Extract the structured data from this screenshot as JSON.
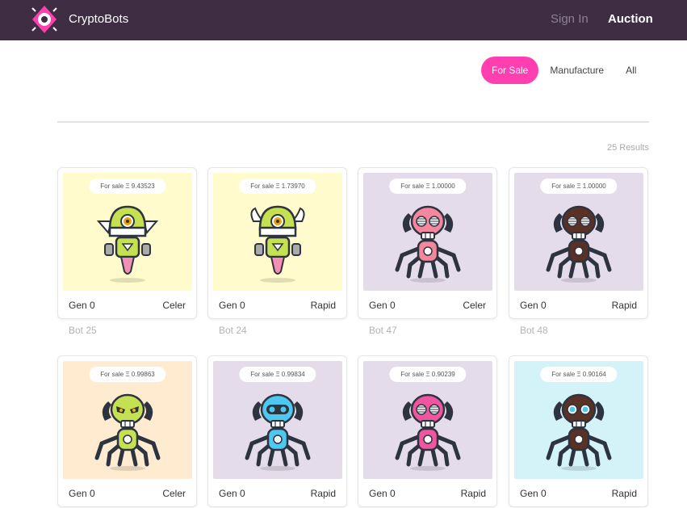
{
  "header": {
    "brand": "CryptoBots",
    "nav": [
      {
        "label": "Sign In"
      },
      {
        "label": "Auction"
      }
    ]
  },
  "filters": [
    {
      "label": "For Sale",
      "active": true
    },
    {
      "label": "Manufacture",
      "active": false
    },
    {
      "label": "All",
      "active": false
    }
  ],
  "results_text": "25 Results",
  "bots": [
    {
      "sale": "For sale Ξ 9.43523",
      "gen": "Gen 0",
      "speed": "Celer",
      "name": "Bot 25",
      "bg": "#fffbcd",
      "style": "drone",
      "color": "#c5e050",
      "eye": "#f0a000"
    },
    {
      "sale": "For sale Ξ 1.73970",
      "gen": "Gen 0",
      "speed": "Rapid",
      "name": "Bot 24",
      "bg": "#fffbcd",
      "style": "drone-wing",
      "color": "#c5e050",
      "eye": "#f0a000"
    },
    {
      "sale": "For sale Ξ 1.00000",
      "gen": "Gen 0",
      "speed": "Celer",
      "name": "Bot 47",
      "bg": "#e5dceb",
      "style": "spider",
      "color": "#f4879d",
      "eye": "grill"
    },
    {
      "sale": "For sale Ξ 1.00000",
      "gen": "Gen 0",
      "speed": "Rapid",
      "name": "Bot 48",
      "bg": "#e5dceb",
      "style": "spider",
      "color": "#5a3124",
      "eye": "grill"
    },
    {
      "sale": "For sale Ξ 0.99863",
      "gen": "Gen 0",
      "speed": "Celer",
      "name": "",
      "bg": "#ffecd0",
      "style": "spider",
      "color": "#c5e050",
      "eye": "angry"
    },
    {
      "sale": "For sale Ξ 0.99834",
      "gen": "Gen 0",
      "speed": "Rapid",
      "name": "",
      "bg": "#e5dceb",
      "style": "spider",
      "color": "#4ec8ee",
      "eye": "visor"
    },
    {
      "sale": "For sale Ξ 0.90239",
      "gen": "Gen 0",
      "speed": "Rapid",
      "name": "",
      "bg": "#e5dceb",
      "style": "spider",
      "color": "#f0559f",
      "eye": "grill"
    },
    {
      "sale": "For sale Ξ 0.90164",
      "gen": "Gen 0",
      "speed": "Rapid",
      "name": "",
      "bg": "#d3f3f8",
      "style": "spider",
      "color": "#5a3124",
      "eye": "goggle"
    }
  ]
}
